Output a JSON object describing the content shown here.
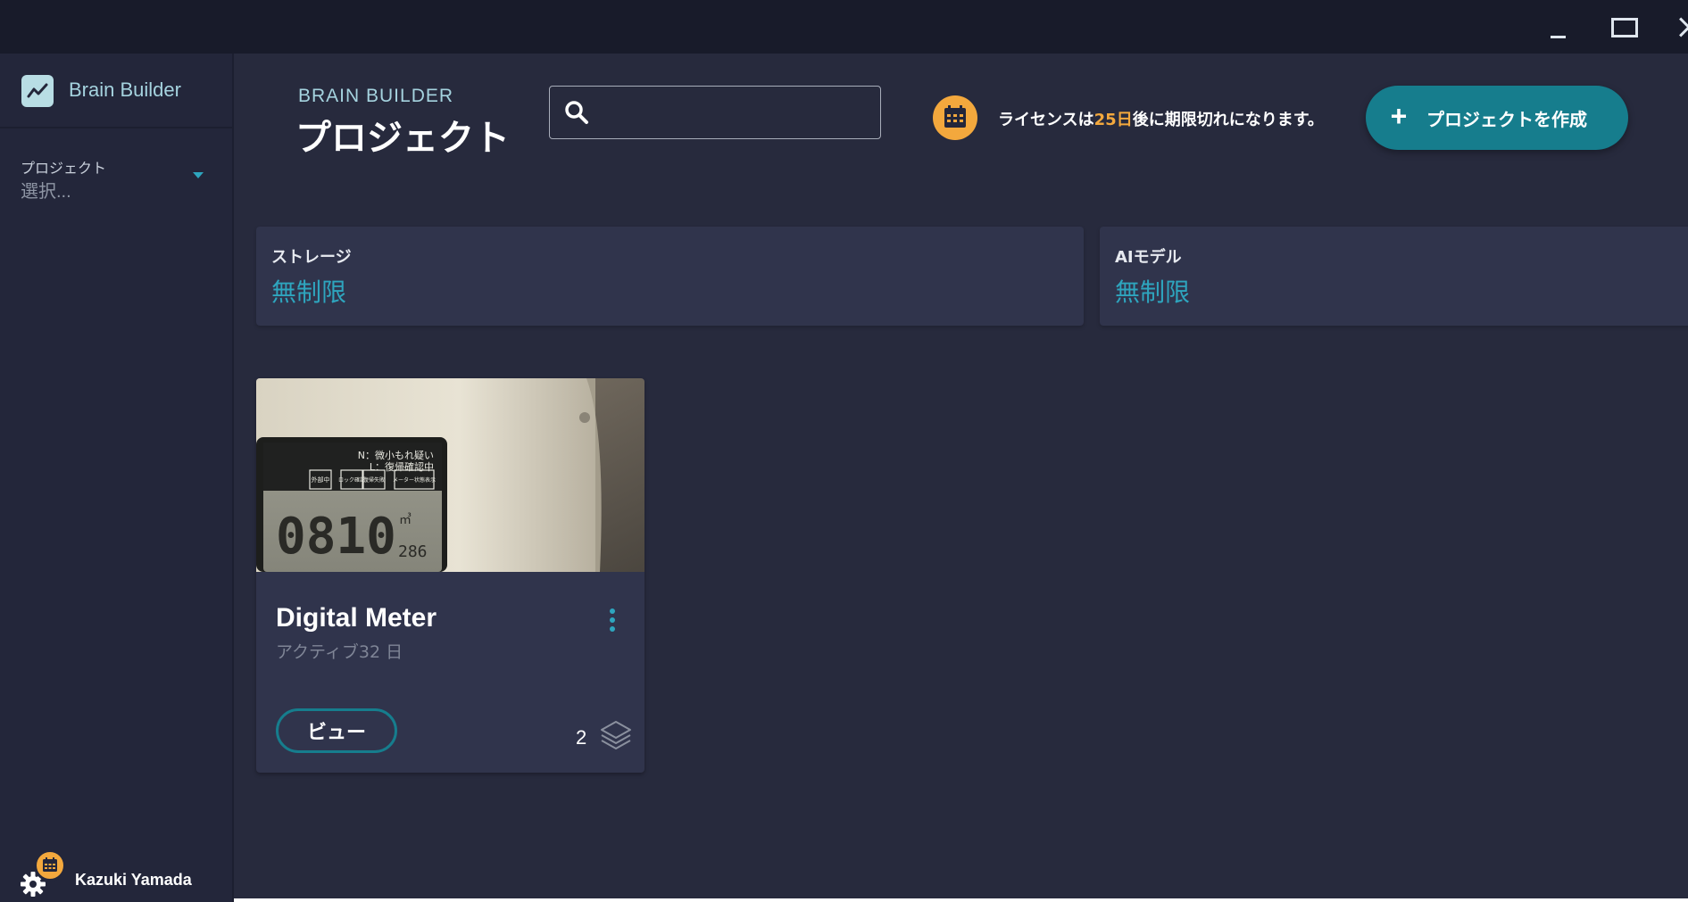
{
  "window": {
    "minimize_icon": "minimize-icon",
    "maximize_icon": "maximize-icon",
    "close_icon": "close-icon"
  },
  "sidebar": {
    "brand_name": "Brain Builder",
    "brand_icon": "trend-line-icon",
    "project_label": "プロジェクト",
    "project_value": "選択...",
    "user_name": "Kazuki Yamada"
  },
  "header": {
    "brand_caps": "BRAIN BUILDER",
    "title": "プロジェクト",
    "search_placeholder": "",
    "license_prefix": "ライセンスは",
    "license_days": "25日",
    "license_suffix": "後に期限切れになります。",
    "create_button": "プロジェクトを作成"
  },
  "stats": [
    {
      "label": "ストレージ",
      "value": "無制限"
    },
    {
      "label": "AIモデル",
      "value": "無制限"
    }
  ],
  "projects": [
    {
      "title": "Digital Meter",
      "subtitle": "アクティブ32 日",
      "view_button": "ビュー",
      "layer_count": "2",
      "thumbnail": {
        "panel_text_1": "N：微小もれ疑い",
        "panel_text_2": "L：復帰確認中",
        "label_a": "外部中",
        "label_b": "ロック確認",
        "label_c": "復帰失敗",
        "label_d": "メーター状態表示",
        "reading": "0810",
        "unit": "㎥",
        "decimal": "286"
      }
    }
  ],
  "colors": {
    "accent": "#2ea5be",
    "button": "#167d8d",
    "warning": "#f3a83d",
    "background": "#272a3d",
    "sidebar": "#23263a",
    "card": "#30344c"
  }
}
